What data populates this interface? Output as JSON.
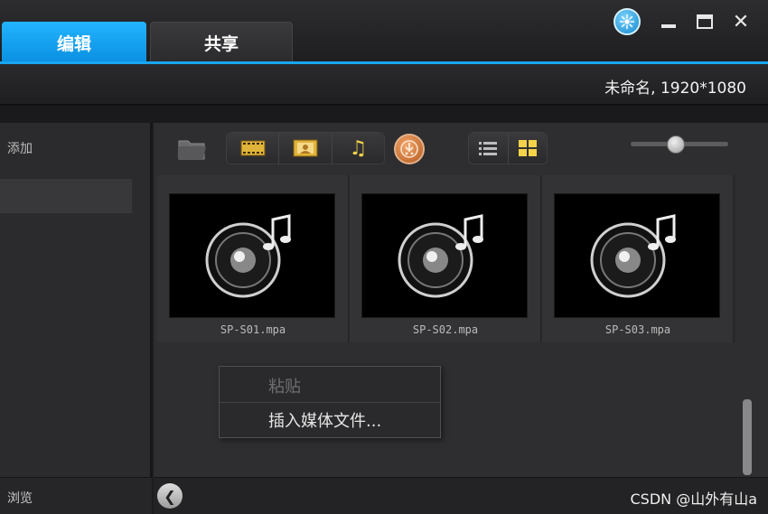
{
  "tabs": [
    {
      "label": "编辑",
      "active": true
    },
    {
      "label": "共享",
      "active": false
    }
  ],
  "window_controls": {
    "upgrade_icon": "upgrade-icon",
    "minimize_icon": "minimize-icon",
    "maximize_icon": "maximize-icon",
    "close_glyph": "✕"
  },
  "project_info": "未命名, 1920*1080",
  "left_panel": {
    "add_label": "添加",
    "browse_label": "浏览"
  },
  "toolbar": {
    "folder_icon": "folder-icon",
    "filters": [
      "video-filter-icon",
      "image-filter-icon",
      "audio-filter-icon"
    ],
    "music_glyph": "♫",
    "capture_icon": "capture-icon",
    "views": [
      "list-view-icon",
      "thumbnail-view-icon"
    ],
    "thumbnail_size": 0.45
  },
  "media_items": [
    {
      "name": "SP-S01.mpa"
    },
    {
      "name": "SP-S02.mpa"
    },
    {
      "name": "SP-S03.mpa"
    }
  ],
  "context_menu": {
    "paste": "粘贴",
    "insert": "插入媒体文件..."
  },
  "scroll_left_glyph": "❮",
  "watermark": "CSDN @山外有山a",
  "colors": {
    "accent": "#1aa6f0",
    "icon_gold": "#f4d24a"
  }
}
